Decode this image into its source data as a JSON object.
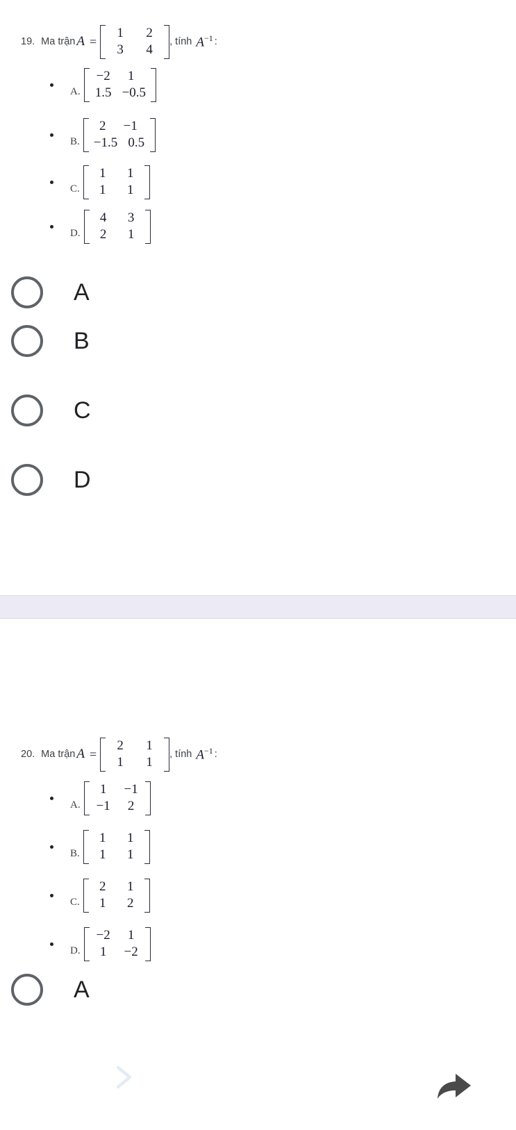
{
  "questions": [
    {
      "number": "19.",
      "prompt_prefix": "Ma trận",
      "var_a": "A",
      "equals": "=",
      "matrix": [
        [
          "1",
          "2"
        ],
        [
          "3",
          "4"
        ]
      ],
      "prompt_suffix": ", tính",
      "var_inv": "A",
      "inv_sup": "−1",
      "colon": ":",
      "options": [
        {
          "letter": "A.",
          "matrix": [
            [
              "−2",
              "1"
            ],
            [
              "1.5",
              "−0.5"
            ]
          ]
        },
        {
          "letter": "B.",
          "matrix": [
            [
              "2",
              "−1"
            ],
            [
              "−1.5",
              "0.5"
            ]
          ]
        },
        {
          "letter": "C.",
          "matrix": [
            [
              "1",
              "1"
            ],
            [
              "1",
              "1"
            ]
          ]
        },
        {
          "letter": "D.",
          "matrix": [
            [
              "4",
              "3"
            ],
            [
              "2",
              "1"
            ]
          ]
        }
      ],
      "choices": [
        "A",
        "B",
        "C",
        "D"
      ]
    },
    {
      "number": "20.",
      "prompt_prefix": "Ma trận",
      "var_a": "A",
      "equals": "=",
      "matrix": [
        [
          "2",
          "1"
        ],
        [
          "1",
          "1"
        ]
      ],
      "prompt_suffix": ", tính",
      "var_inv": "A",
      "inv_sup": "−1",
      "colon": ":",
      "options": [
        {
          "letter": "A.",
          "matrix": [
            [
              "1",
              "−1"
            ],
            [
              "−1",
              "2"
            ]
          ]
        },
        {
          "letter": "B.",
          "matrix": [
            [
              "1",
              "1"
            ],
            [
              "1",
              "1"
            ]
          ]
        },
        {
          "letter": "C.",
          "matrix": [
            [
              "2",
              "1"
            ],
            [
              "1",
              "2"
            ]
          ]
        },
        {
          "letter": "D.",
          "matrix": [
            [
              "−2",
              "1"
            ],
            [
              "1",
              "−2"
            ]
          ]
        }
      ],
      "choices": [
        "A"
      ]
    }
  ],
  "bottom_nav": {
    "next_icon": "chevron-right-icon",
    "share_icon": "share-forward-icon"
  },
  "colors": {
    "band": "#eceaf4",
    "radio_border": "#5f6368",
    "chevron": "#e3ecf5",
    "share": "#4a4a4a",
    "math": "#1a1a2e",
    "text": "#3c4043"
  }
}
